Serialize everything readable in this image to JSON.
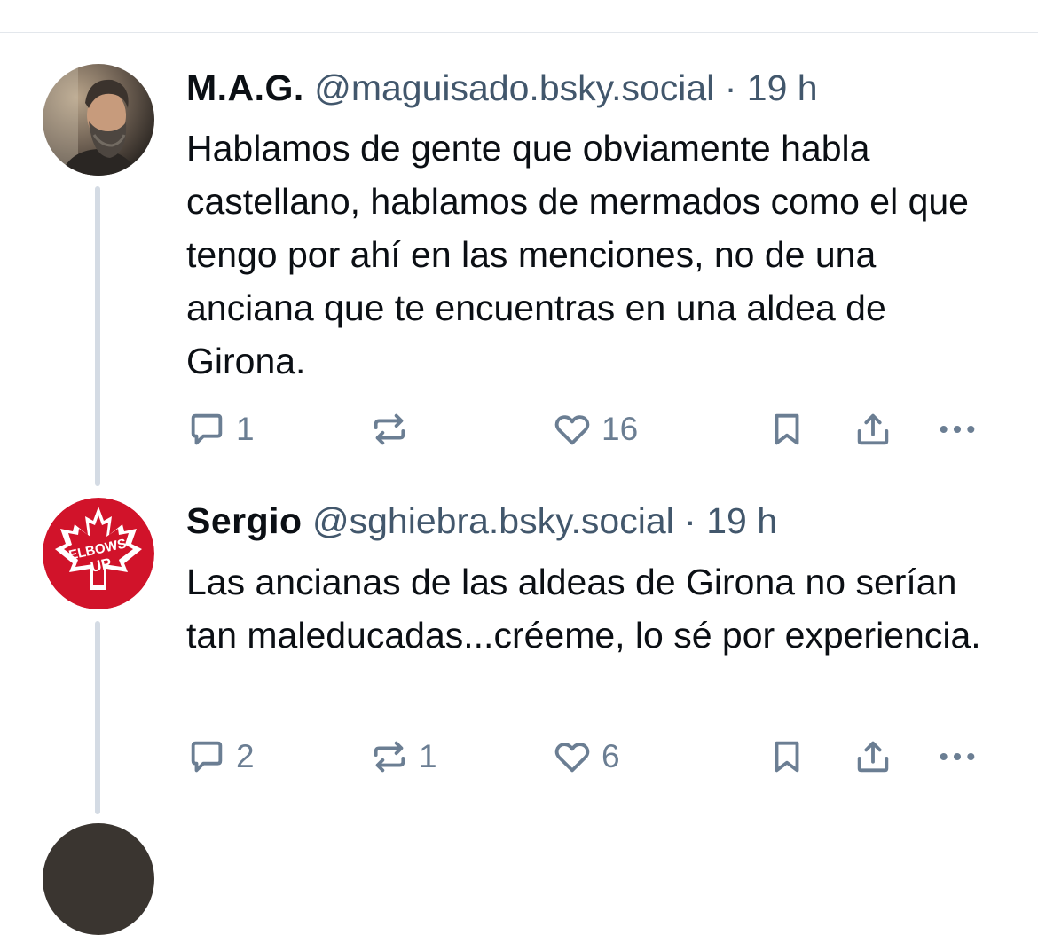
{
  "posts": [
    {
      "display_name": "M.A.G.",
      "handle": "@maguisado.bsky.social",
      "separator": "·",
      "time": "19 h",
      "text": "Hablamos de gente que obviamente habla castellano, hablamos de mermados como el que tengo por ahí en las menciones, no de una anciana que te encuentras en una aldea de Girona.",
      "reply_count": "1",
      "repost_count": "",
      "like_count": "16"
    },
    {
      "display_name": "Sergio",
      "handle": "@sghiebra.bsky.social",
      "separator": "·",
      "time": "19 h",
      "text": "Las ancianas de las aldeas de Girona no serían tan maleducadas...créeme, lo sé por experiencia.",
      "reply_count": "2",
      "repost_count": "1",
      "like_count": "6",
      "avatar_badge_text": "ELBOWS UP"
    }
  ],
  "icons": [
    "reply-icon",
    "repost-icon",
    "like-icon",
    "bookmark-icon",
    "share-icon",
    "more-icon"
  ],
  "colors": {
    "text": "#0b0f14",
    "secondary": "#42576c",
    "icon": "#6b7e93",
    "thread_line": "#d4dbe4",
    "badge_red": "#d1132a"
  }
}
